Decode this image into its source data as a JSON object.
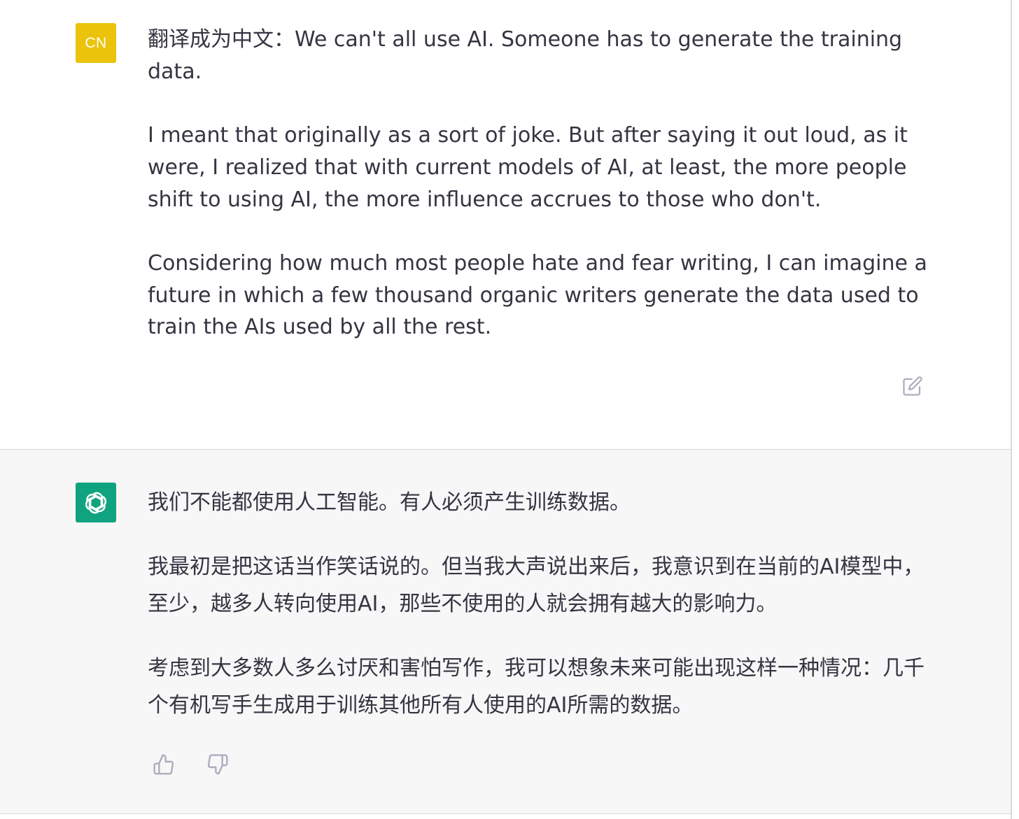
{
  "user_turn": {
    "avatar_initials": "CN",
    "avatar_color": "#ecc30b",
    "paragraphs": [
      "翻译成为中文：We can't all use AI. Someone has to generate the training data.",
      "I meant that originally as a sort of joke. But after saying it out loud, as it were, I realized that with current models of AI, at least, the more people shift to using AI, the more influence accrues to those who don't.",
      "Considering how much most people hate and fear writing, I can imagine a future in which a few thousand organic writers generate the data used to train the AIs used by all the rest."
    ],
    "edit_icon": "edit-icon"
  },
  "assistant_turn": {
    "avatar_icon": "openai-logo-icon",
    "avatar_color": "#10a37f",
    "paragraphs": [
      "我们不能都使用人工智能。有人必须产生训练数据。",
      "我最初是把这话当作笑话说的。但当我大声说出来后，我意识到在当前的AI模型中，至少，越多人转向使用AI，那些不使用的人就会拥有越大的影响力。",
      "考虑到大多数人多么讨厌和害怕写作，我可以想象未来可能出现这样一种情况：几千个有机写手生成用于训练其他所有人使用的AI所需的数据。"
    ],
    "feedback_icons": [
      "thumbs-up-icon",
      "thumbs-down-icon"
    ]
  }
}
